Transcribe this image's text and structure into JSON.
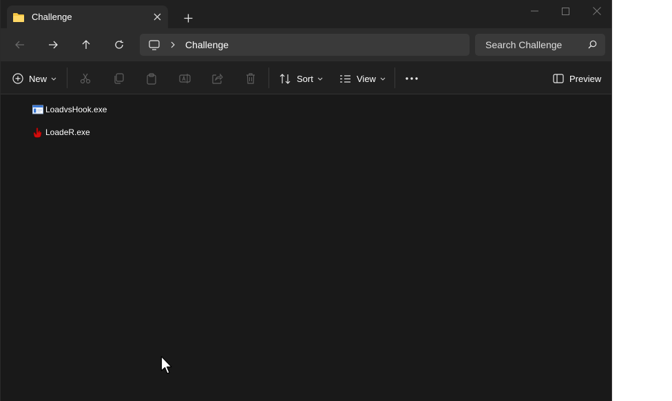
{
  "window": {
    "tab": {
      "title": "Challenge",
      "close_glyph": "✕"
    },
    "new_tab_glyph": "+"
  },
  "nav": {
    "address_path": "Challenge",
    "search_placeholder": "Search Challenge"
  },
  "commands": {
    "new_label": "New",
    "sort_label": "Sort",
    "view_label": "View",
    "preview_label": "Preview"
  },
  "files": [
    {
      "name": "LoadvsHook.exe",
      "icon": "exe-window-icon"
    },
    {
      "name": "LoadeR.exe",
      "icon": "hand-icon"
    }
  ],
  "colors": {
    "window_bg": "#191919",
    "titlebar_bg": "#202020",
    "navrow_bg": "#2c2c2c",
    "address_bg": "#3a3a3a",
    "folder_yellow": "#f4c542",
    "hand_red": "#d20c0c",
    "exe_blue": "#3a78d6"
  }
}
